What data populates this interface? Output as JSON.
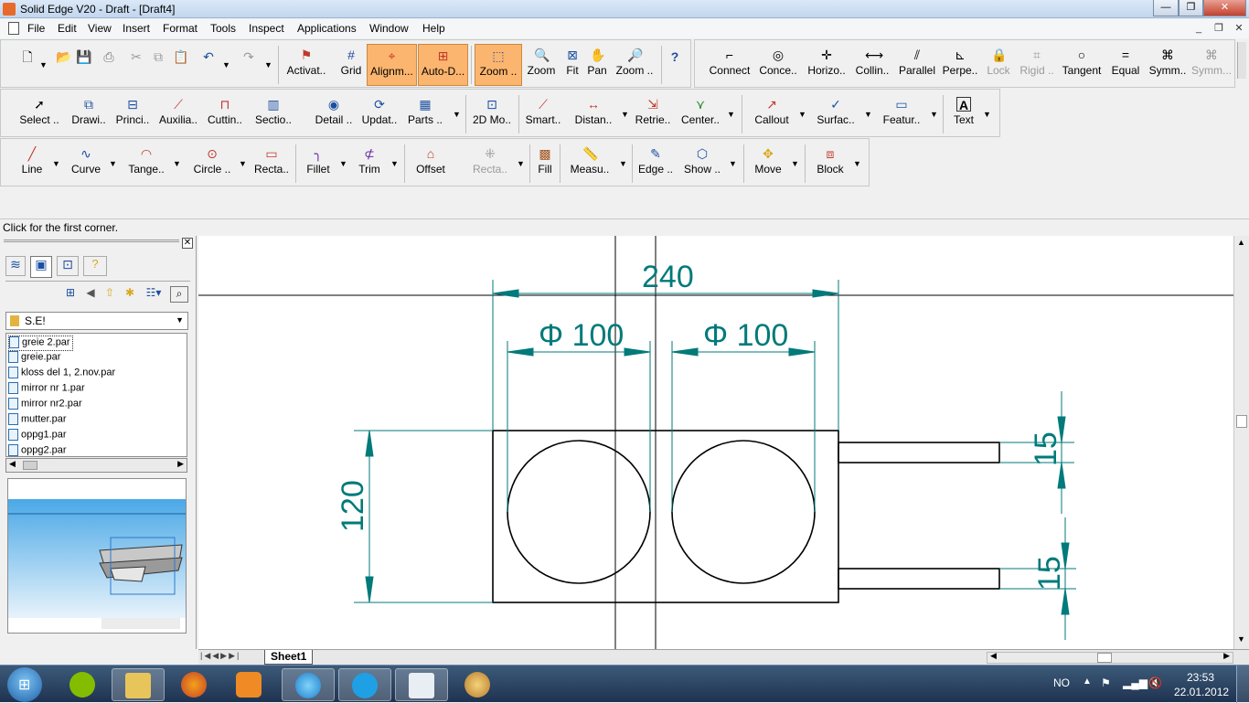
{
  "window": {
    "title": "Solid Edge V20 - Draft - [Draft4]",
    "buttons": [
      "—",
      "❐",
      "✕"
    ]
  },
  "menu": {
    "items": [
      "File",
      "Edit",
      "View",
      "Insert",
      "Format",
      "Tools",
      "Inspect",
      "Applications",
      "Window",
      "Help"
    ]
  },
  "toolbar1": {
    "activate": "Activat..",
    "grid": "Grid",
    "alignment": "Alignm...",
    "auto_dimension": "Auto-D...",
    "zoom_area": "Zoom ..",
    "zoom": "Zoom",
    "fit": "Fit",
    "pan": "Pan",
    "zoom_tool": "Zoom ..",
    "help_icon": "?"
  },
  "relations": {
    "connect": "Connect",
    "concentric": "Conce..",
    "horizontal": "Horizo..",
    "collinear": "Collin..",
    "parallel": "Parallel",
    "perpendicular": "Perpe..",
    "lock": "Lock",
    "rigid": "Rigid ..",
    "tangent": "Tangent",
    "equal": "Equal",
    "symmetric": "Symm..",
    "symmetric2": "Symm..."
  },
  "toolbar2": {
    "select": "Select ..",
    "drawing_view": "Drawi..",
    "principal": "Princi..",
    "auxiliary": "Auxilia..",
    "cutting": "Cuttin..",
    "section": "Sectio..",
    "detail": "Detail ..",
    "update": "Updat..",
    "parts": "Parts ..",
    "model_2d": "2D Mo..",
    "smart": "Smart..",
    "distance": "Distan..",
    "retrieve": "Retrie..",
    "center": "Center..",
    "callout": "Callout",
    "surface": "Surfac..",
    "feature": "Featur..",
    "text": "Text"
  },
  "toolbar3": {
    "line": "Line",
    "curve": "Curve",
    "tangent": "Tange..",
    "circle": "Circle ..",
    "rectangle": "Recta..",
    "fillet": "Fillet",
    "trim": "Trim",
    "offset": "Offset",
    "rectangle2": "Recta..",
    "fill": "Fill",
    "measure": "Measu..",
    "edge": "Edge ..",
    "show": "Show ..",
    "move": "Move",
    "block": "Block"
  },
  "status": {
    "prompt": "Click for the first corner."
  },
  "library": {
    "folder": "S.E!",
    "files": [
      "greie 2.par",
      "greie.par",
      "kloss del 1, 2.nov.par",
      "mirror nr 1.par",
      "mirror nr2.par",
      "mutter.par",
      "oppg1.par",
      "oppg2.par"
    ]
  },
  "drawing": {
    "dim_overall": "240",
    "dim_hole1": "Φ 100",
    "dim_hole2": "Φ 100",
    "dim_height": "120",
    "dim_slot1": "15",
    "dim_slot2": "15",
    "line_color": "#000000",
    "dim_color": "#007a7a"
  },
  "sheet": {
    "tab": "Sheet1"
  },
  "taskbar": {
    "language": "NO",
    "time": "23:53",
    "date": "22.01.2012"
  }
}
